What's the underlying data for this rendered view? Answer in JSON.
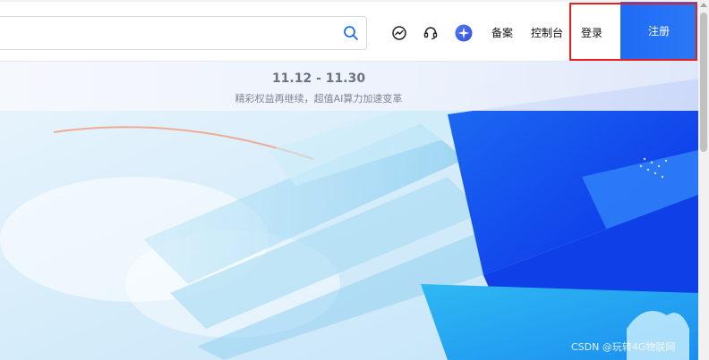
{
  "header": {
    "search": {
      "value": "",
      "placeholder": ""
    },
    "nav_icons": [
      "dashboard-icon",
      "headset-icon",
      "ai-assistant-icon"
    ],
    "nav_links": {
      "beian": "备案",
      "console": "控制台"
    },
    "login_label": "登录",
    "register_label": "注册",
    "colors": {
      "accent": "#1f6cf5",
      "highlight": "#e81d1d"
    }
  },
  "banner": {
    "date_range": "11.12 - 11.30",
    "subtitle": "精彩权益再继续，超值AI算力加速变革"
  },
  "watermark": "CSDN @玩转4G物联网"
}
